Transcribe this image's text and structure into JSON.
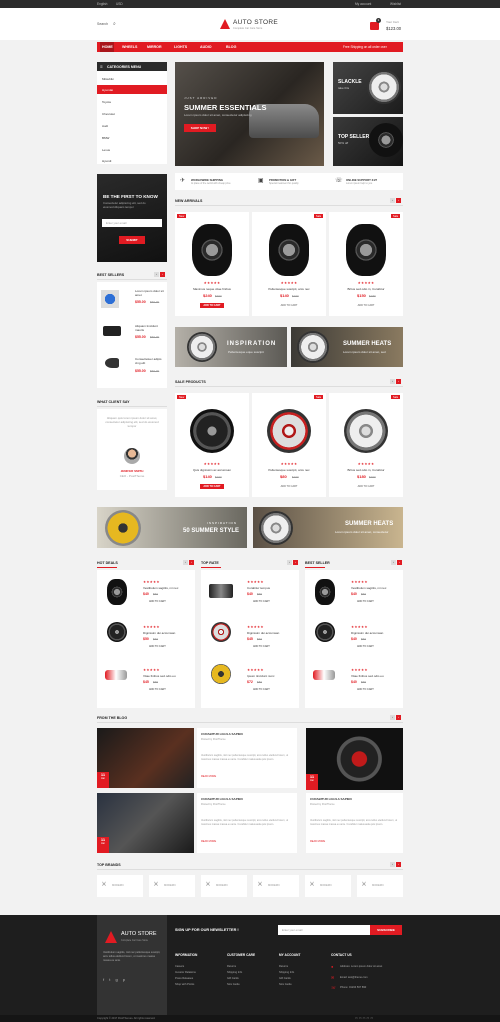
{
  "topbar": {
    "language": "English",
    "currency": "USD",
    "account": "My account",
    "wishlist": "Wishlist"
  },
  "header": {
    "search": "Search",
    "logo": "AUTO STORE",
    "tagline": "Complete Car Care Store",
    "cart_label": "Your Cart",
    "cart_total": "$123.00",
    "cart_count": "1"
  },
  "nav": {
    "items": [
      "HOME",
      "WHEELS",
      "MIRROR",
      "LIGHTS",
      "AUDIO",
      "BLOG"
    ],
    "shipping": "Free Shipping on all order over"
  },
  "categories": {
    "title": "CATEGORIES MENU",
    "items": [
      "Mitsubiki",
      "Hyundai",
      "Toyota",
      "Chevrolet",
      "Audi",
      "BMW",
      "Lexus",
      "Hyundi"
    ]
  },
  "hero": {
    "kicker": "JUST ARRIVED",
    "title": "SUMMER ESSENTIALS",
    "subtitle": "Lorem ipsum dolor sit amet, consectetur adipiscing",
    "button": "SHOP NOW !"
  },
  "side_banners": [
    {
      "title": "SLACKLE",
      "subtitle": "take this"
    },
    {
      "title": "TOP SELLER",
      "subtitle": "50% off"
    }
  ],
  "features": [
    {
      "title": "WORLDWIDE SHIPPING",
      "text": "At place of the world with cheap price"
    },
    {
      "title": "PROMOTION & GIFT",
      "text": "Special treatment for quality"
    },
    {
      "title": "ONLINE SUPPORT 24/7",
      "text": "Lorem ipsum help to you"
    }
  ],
  "subscribe": {
    "title": "BE THE FIRST TO KNOW",
    "text": "Consectetur adipiscing elit, sed do eiusmod Aliquam tempor",
    "placeholder": "Enter your email",
    "button": "SUBMIT"
  },
  "best_sellers": {
    "title": "BEST SELLERS",
    "items": [
      {
        "name": "Lorem ipsum dolor sit amet",
        "price": "$55.00",
        "old": "$59.00"
      },
      {
        "name": "Aliquam tincidunt mauris",
        "price": "$55.00",
        "old": "$59.00"
      },
      {
        "name": "Consectetuer adipis cing elit",
        "price": "$55.00",
        "old": "$59.00"
      }
    ]
  },
  "testimonial": {
    "title": "WHAT CLIENT SAY",
    "text": "Aliquam quis lorem ipsum dolor sit amet, consectetur adipiscing elit, sed do eiusmod tempor",
    "name": "JENIFER SMITH",
    "role": "CEO - PostTheme"
  },
  "new_arrivals": {
    "title": "NEW ARRIVALS",
    "products": [
      {
        "badge": "New",
        "name": "Maximus neque vitae finibus",
        "price": "$240",
        "old": "$360",
        "button": "ADD TO CART"
      },
      {
        "badge": "Sale",
        "name": "Pellentesque suscipit, arcu nec",
        "price": "$140",
        "old": "$160",
        "button": "ADD TO CART"
      },
      {
        "badge": "Sale",
        "name": "Britus sed odio in, Curabitur",
        "price": "$150",
        "old": "$180",
        "button": "ADD TO CART"
      }
    ]
  },
  "banners_mid": [
    {
      "kicker": "INSPIRATION",
      "text": "Pellentesque eque suscipit"
    },
    {
      "kicker": "SUMMER HEATS",
      "text": "Lorem ipsum dolor sit amet, sed"
    }
  ],
  "sale_products": {
    "title": "SALE PRODUCTS",
    "products": [
      {
        "badge": "New",
        "name": "Quis dignissim ac accumsan",
        "price": "$140",
        "old": "$160",
        "button": "ADD TO CART"
      },
      {
        "badge": "Sale",
        "name": "Pellentesque suscipit, arcu nec",
        "price": "$80",
        "old": "$100",
        "button": "ADD TO CART"
      },
      {
        "badge": "Sale",
        "name": "Britus sed odio in, Curabitur",
        "price": "$180",
        "old": "$200",
        "button": "ADD TO CART"
      }
    ]
  },
  "banners_wide": [
    {
      "kicker": "INSPIRATION",
      "title": "50 SUMMER STYLE"
    },
    {
      "kicker": "SUMMER HEATS",
      "text": "Lorem ipsum dolor sit amet, consectetur"
    }
  ],
  "lists": [
    {
      "title": "HOT DEALS",
      "items": [
        {
          "name": "Vestibulum sagittis, mi nec",
          "price": "$40",
          "old": "$50",
          "button": "ADD TO CART"
        },
        {
          "name": "Dignissim dui accumsan",
          "price": "$50",
          "old": "$60",
          "button": "ADD TO CART"
        },
        {
          "name": "Vitae finibus sed odio eu",
          "price": "$45",
          "old": "$55",
          "button": "ADD TO CART"
        }
      ]
    },
    {
      "title": "TOP RATE",
      "items": [
        {
          "name": "Curabitur tempus",
          "price": "$40",
          "old": "$55",
          "button": "ADD TO CART"
        },
        {
          "name": "Dignissim dui accumsan",
          "price": "$45",
          "old": "$60",
          "button": "ADD TO CART"
        },
        {
          "name": "Ipsum tincidunt nunc",
          "price": "$72",
          "old": "$80",
          "button": "ADD TO CART"
        }
      ]
    },
    {
      "title": "BEST SELLER",
      "items": [
        {
          "name": "Vestibulum sagittis, mi nec",
          "price": "$40",
          "old": "$50",
          "button": "ADD TO CART"
        },
        {
          "name": "Dignissim dui accumsan",
          "price": "$40",
          "old": "$50",
          "button": "ADD TO CART"
        },
        {
          "name": "Vitae finibus sed odio eu",
          "price": "$40",
          "old": "$55",
          "button": "ADD TO CART"
        }
      ]
    }
  ],
  "blog": {
    "title": "FROM THE BLOG",
    "posts": [
      {
        "day": "11",
        "month": "Jan",
        "title": "CURABITUR LIGULA SAPIEN",
        "by": "Posted by PostTheme",
        "text": "Vestibulum sagittis, nisl nec pellentesque suscipit, arcu tellus eleifend lorem, ut maximus massa massa eu ante. Curabitur malesuada quis ipsum.",
        "more": "READ MORE"
      },
      {
        "day": "11",
        "month": "Jan",
        "title": "CURABITUR LIGULA SAPIEN",
        "by": "Posted by PostTheme",
        "text": "Vestibulum sagittis, nisl nec pellentesque suscipit, arcu tellus eleifend lorem, ut maximus massa massa eu ante. Curabitur malesuada quis ipsum.",
        "more": "READ MORE"
      },
      {
        "day": "11",
        "month": "Jan",
        "title": "CURABITUR LIGULA SAPIEN",
        "by": "Posted by PostTheme",
        "text": "Vestibulum sagittis, nisl nec pellentesque suscipit, arcu tellus eleifend lorem, ut maximus massa massa eu ante. Curabitur malesuada quis ipsum.",
        "more": "READ MORE"
      }
    ]
  },
  "brands": {
    "title": "TOP BRANDS",
    "items": [
      "MODERN",
      "MODERN",
      "MODERN",
      "MODERN",
      "MODERN",
      "MODERN"
    ]
  },
  "footer": {
    "logo": "AUTO STORE",
    "tagline": "Complete Car Care Store",
    "about": "Vestibulum sagittis, nisl nec pellentesque suscipit, arcu tellus eleifend lorem, ut maximus massa massa eu ante.",
    "newsletter": "SIGN UP FOR OUR NEWSLETTER !",
    "placeholder": "Enter your email",
    "subscribe": "SUBSCRIBE",
    "cols": [
      {
        "title": "INFORMATION",
        "links": [
          "Careers",
          "Investor Relations",
          "Press Releases",
          "Shop with Points"
        ]
      },
      {
        "title": "CUSTOMER CARE",
        "links": [
          "Returns",
          "Shipping Info",
          "Gift Cards",
          "Size Guide"
        ]
      },
      {
        "title": "MY ACCOUNT",
        "links": [
          "Returns",
          "Shipping Info",
          "Gift Cards",
          "Size Guide"
        ]
      },
      {
        "title": "CONTACT US",
        "links": [
          "Address: Lorem ipsum dolor sit amet",
          "Email: test@theme.com",
          "Phone: 01234 567 890"
        ]
      }
    ],
    "copyright": "Copyright © 2017 PostThemes. All rights reserved."
  },
  "colors": {
    "accent": "#e11b22",
    "dark": "#2b2b2b"
  }
}
